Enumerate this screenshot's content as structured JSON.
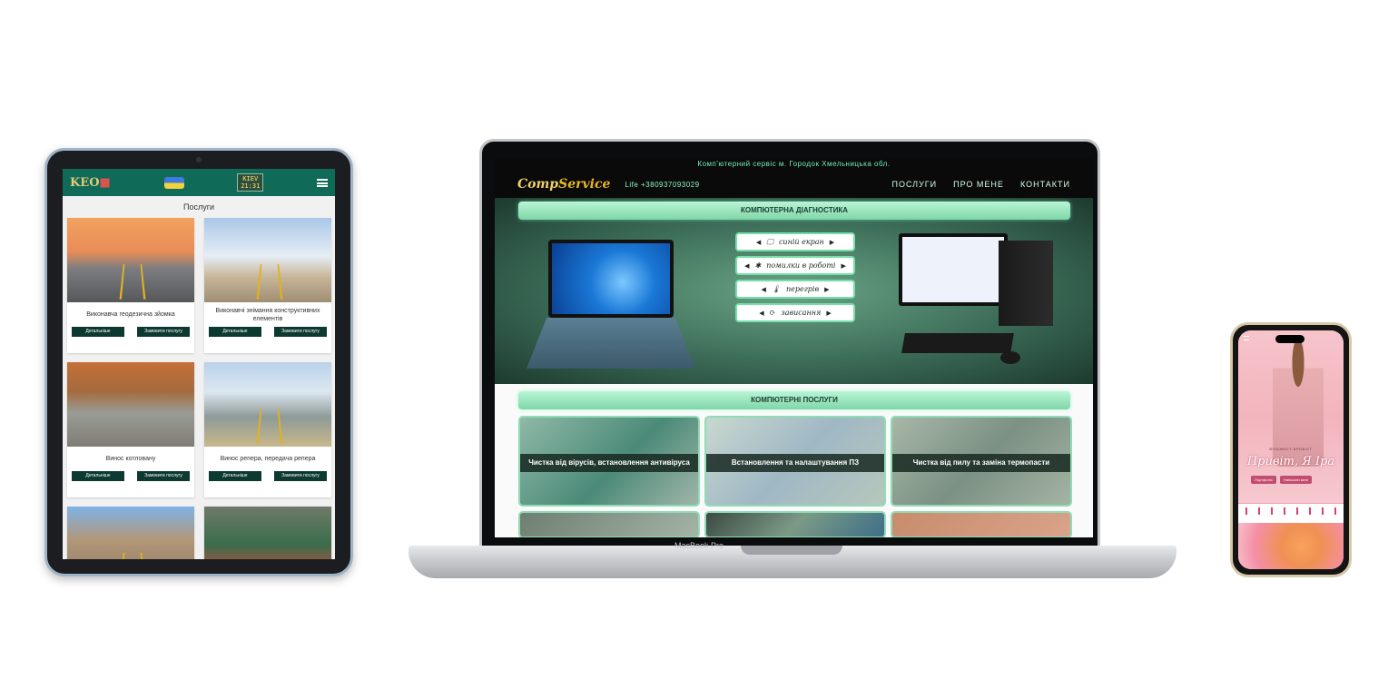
{
  "tablet": {
    "logo": "KEO",
    "clock_city": "KIEV",
    "clock_time": "21:31",
    "section_title": "Послуги",
    "cards": [
      {
        "title": "Виконавча геодезична зйомка",
        "details": "Детальніше",
        "order": "Замовити послугу"
      },
      {
        "title": "Виконавчі знімання конструктивних елементів",
        "details": "Детальніше",
        "order": "Замовити послугу"
      },
      {
        "title": "Винос котловану",
        "details": "Детальніше",
        "order": "Замовити послугу"
      },
      {
        "title": "Винос репера, передача репера",
        "details": "Детальніше",
        "order": "Замовити послугу"
      }
    ]
  },
  "laptop": {
    "topline": "Комп'ютерний сервіс м. Городок Хмельницька обл.",
    "logo_main": "Comp",
    "logo_accent": "Service",
    "phone": "Life +380937093029",
    "menu": [
      "ПОСЛУГИ",
      "ПРО МЕНЕ",
      "КОНТАКТИ"
    ],
    "diagnostics_title": "КОМПЮТЕРНА ДІАГНОСТИКА",
    "diagnostics": [
      {
        "icon": "🖵",
        "label": "синій екран"
      },
      {
        "icon": "✱",
        "label": "помилки в роботі"
      },
      {
        "icon": "🌡",
        "label": "перегрів"
      },
      {
        "icon": "⟳",
        "label": "зависання"
      }
    ],
    "services_title": "КОМПЮТЕРНІ ПОСЛУГИ",
    "services": [
      "Чистка від вірусів, встановлення антивіруса",
      "Встановлення та налаштування ПЗ",
      "Чистка від пилу та заміна термопасти",
      "",
      "",
      ""
    ],
    "brand": "MacBook Pro"
  },
  "phone": {
    "subtitle": "ВІЗАЖИСТ-БРОВІСТ",
    "title": "Привіт, Я Іра",
    "btn_portfolio": "Портфоліо",
    "btn_write": "Написати мені"
  }
}
